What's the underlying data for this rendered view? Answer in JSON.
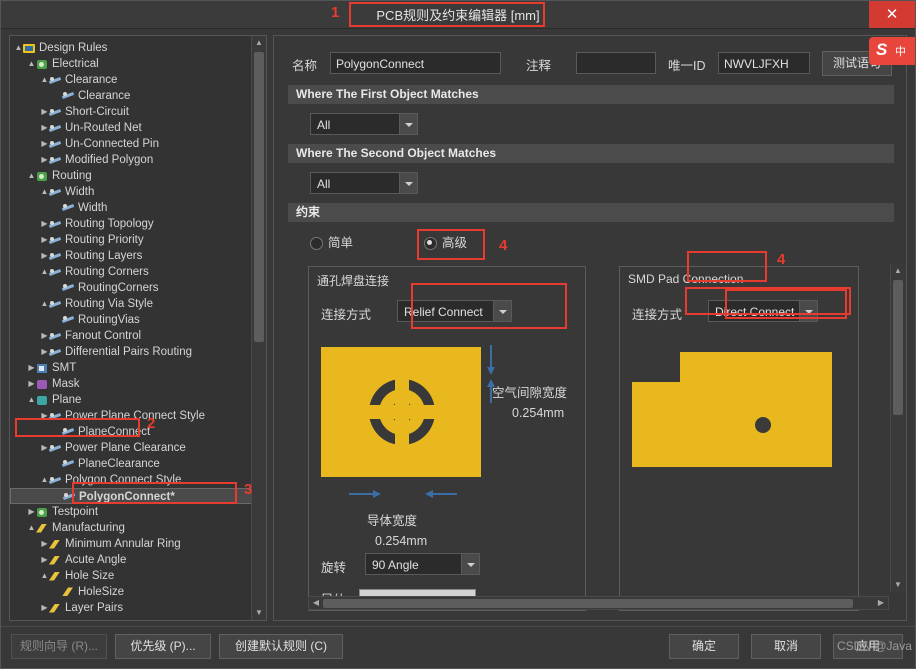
{
  "window": {
    "title": "PCB规则及约束编辑器 [mm]",
    "close_label": "✕"
  },
  "annotations": [
    {
      "num": "1"
    },
    {
      "num": "2"
    },
    {
      "num": "3"
    },
    {
      "num": "4"
    }
  ],
  "tree": {
    "items": [
      {
        "label": "Design Rules",
        "indent": 0,
        "twisty": "▲",
        "icon": "folder-icon"
      },
      {
        "label": "Electrical",
        "indent": 1,
        "twisty": "▲",
        "icon": "green-icon"
      },
      {
        "label": "Clearance",
        "indent": 2,
        "twisty": "▲",
        "icon": "track-icon"
      },
      {
        "label": "Clearance",
        "indent": 3,
        "twisty": "",
        "icon": "track-icon"
      },
      {
        "label": "Short-Circuit",
        "indent": 2,
        "twisty": "▶",
        "icon": "track-icon"
      },
      {
        "label": "Un-Routed Net",
        "indent": 2,
        "twisty": "▶",
        "icon": "track-icon"
      },
      {
        "label": "Un-Connected Pin",
        "indent": 2,
        "twisty": "▶",
        "icon": "track-icon"
      },
      {
        "label": "Modified Polygon",
        "indent": 2,
        "twisty": "▶",
        "icon": "track-icon"
      },
      {
        "label": "Routing",
        "indent": 1,
        "twisty": "▲",
        "icon": "green-icon"
      },
      {
        "label": "Width",
        "indent": 2,
        "twisty": "▲",
        "icon": "track-icon"
      },
      {
        "label": "Width",
        "indent": 3,
        "twisty": "",
        "icon": "track-icon"
      },
      {
        "label": "Routing Topology",
        "indent": 2,
        "twisty": "▶",
        "icon": "track-icon"
      },
      {
        "label": "Routing Priority",
        "indent": 2,
        "twisty": "▶",
        "icon": "track-icon"
      },
      {
        "label": "Routing Layers",
        "indent": 2,
        "twisty": "▶",
        "icon": "track-icon"
      },
      {
        "label": "Routing Corners",
        "indent": 2,
        "twisty": "▲",
        "icon": "track-icon"
      },
      {
        "label": "RoutingCorners",
        "indent": 3,
        "twisty": "",
        "icon": "track-icon"
      },
      {
        "label": "Routing Via Style",
        "indent": 2,
        "twisty": "▲",
        "icon": "track-icon"
      },
      {
        "label": "RoutingVias",
        "indent": 3,
        "twisty": "",
        "icon": "track-icon"
      },
      {
        "label": "Fanout Control",
        "indent": 2,
        "twisty": "▶",
        "icon": "track-icon"
      },
      {
        "label": "Differential Pairs Routing",
        "indent": 2,
        "twisty": "▶",
        "icon": "track-icon"
      },
      {
        "label": "SMT",
        "indent": 1,
        "twisty": "▶",
        "icon": "blue-icon"
      },
      {
        "label": "Mask",
        "indent": 1,
        "twisty": "▶",
        "icon": "purple-icon"
      },
      {
        "label": "Plane",
        "indent": 1,
        "twisty": "▲",
        "icon": "teal-icon"
      },
      {
        "label": "Power Plane Connect Style",
        "indent": 2,
        "twisty": "▶",
        "icon": "track-icon"
      },
      {
        "label": "PlaneConnect",
        "indent": 3,
        "twisty": "",
        "icon": "track-icon"
      },
      {
        "label": "Power Plane Clearance",
        "indent": 2,
        "twisty": "▶",
        "icon": "track-icon"
      },
      {
        "label": "PlaneClearance",
        "indent": 3,
        "twisty": "",
        "icon": "track-icon"
      },
      {
        "label": "Polygon Connect Style",
        "indent": 2,
        "twisty": "▲",
        "icon": "track-icon"
      },
      {
        "label": "PolygonConnect*",
        "indent": 3,
        "twisty": "",
        "icon": "track-icon",
        "selected": true
      },
      {
        "label": "Testpoint",
        "indent": 1,
        "twisty": "▶",
        "icon": "green-icon"
      },
      {
        "label": "Manufacturing",
        "indent": 1,
        "twisty": "▲",
        "icon": "yellow-icon"
      },
      {
        "label": "Minimum Annular Ring",
        "indent": 2,
        "twisty": "▶",
        "icon": "yellow-icon"
      },
      {
        "label": "Acute Angle",
        "indent": 2,
        "twisty": "▶",
        "icon": "yellow-icon"
      },
      {
        "label": "Hole Size",
        "indent": 2,
        "twisty": "▲",
        "icon": "yellow-icon"
      },
      {
        "label": "HoleSize",
        "indent": 3,
        "twisty": "",
        "icon": "yellow-icon"
      },
      {
        "label": "Layer Pairs",
        "indent": 2,
        "twisty": "▶",
        "icon": "yellow-icon"
      }
    ]
  },
  "form": {
    "name_label": "名称",
    "name_value": "PolygonConnect",
    "comment_label": "注释",
    "comment_value": "",
    "uid_label": "唯一ID",
    "uid_value": "NWVLJFXH",
    "test_query_button": "测试语句",
    "first_object_header": "Where The First Object Matches",
    "first_object_value": "All",
    "second_object_header": "Where The Second Object Matches",
    "second_object_value": "All",
    "constraints_header": "约束",
    "mode_simple": "简单",
    "mode_advanced": "高级",
    "mode_selected": "高级"
  },
  "through_hole": {
    "group_title": "通孔焊盘连接",
    "connect_label": "连接方式",
    "connect_value": "Relief Connect",
    "air_gap_label": "空气间隙宽度",
    "air_gap_value": "0.254mm",
    "conductor_width_label": "导体宽度",
    "conductor_width_value": "0.254mm",
    "rotation_label": "旋转",
    "rotation_value": "90 Angle",
    "conductor_label": "导体"
  },
  "smd": {
    "group_title": "SMD Pad Connection",
    "connect_label": "连接方式",
    "connect_value": "Direct Connect"
  },
  "footer": {
    "rule_wizard": "规则向导 (R)...",
    "priority": "优先级 (P)...",
    "create_default": "创建默认规则 (C)",
    "ok": "确定",
    "cancel": "取消",
    "apply": "应用"
  },
  "watermark": {
    "text": "CSDN @Java"
  },
  "ime": {
    "letter": "S",
    "label": "中"
  }
}
